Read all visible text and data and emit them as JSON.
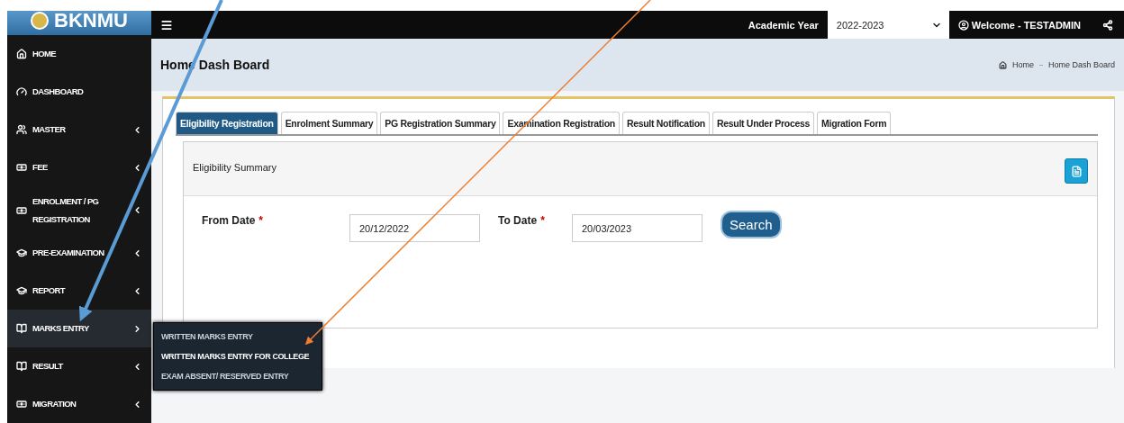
{
  "logo": {
    "text": "BKNMU"
  },
  "top_bar": {
    "academic_year_label": "Academic Year",
    "academic_year": "2022-2023",
    "welcome": "Welcome - TESTADMIN"
  },
  "sidebar": {
    "items": [
      {
        "label": "HOME",
        "has_submenu": false,
        "expanded": false
      },
      {
        "label": "DASHBOARD",
        "has_submenu": false,
        "expanded": false
      },
      {
        "label": "MASTER",
        "has_submenu": true,
        "expanded": false
      },
      {
        "label": "FEE",
        "has_submenu": true,
        "expanded": false
      },
      {
        "label": "ENROLMENT / PG REGISTRATION",
        "has_submenu": true,
        "expanded": false
      },
      {
        "label": "PRE-EXAMINATION",
        "has_submenu": true,
        "expanded": false
      },
      {
        "label": "REPORT",
        "has_submenu": true,
        "expanded": false
      },
      {
        "label": "MARKS ENTRY",
        "has_submenu": true,
        "expanded": true,
        "children": [
          {
            "label": "WRITTEN MARKS ENTRY",
            "selected": false
          },
          {
            "label": "WRITTEN MARKS ENTRY FOR COLLEGE",
            "selected": true
          },
          {
            "label": "EXAM ABSENT/ RESERVED ENTRY",
            "selected": false
          }
        ]
      },
      {
        "label": "RESULT",
        "has_submenu": true,
        "expanded": false
      },
      {
        "label": "MIGRATION",
        "has_submenu": true,
        "expanded": false
      }
    ]
  },
  "page_header": {
    "title": "Home Dash Board",
    "breadcrumbs": [
      "Home",
      "Home Dash Board"
    ]
  },
  "tabs": [
    {
      "label": "Eligibility Registration",
      "selected": true
    },
    {
      "label": "Enrolment Summary",
      "selected": false
    },
    {
      "label": "PG Registration Summary",
      "selected": false
    },
    {
      "label": "Examination Registration",
      "selected": false
    },
    {
      "label": "Result Notification",
      "selected": false
    },
    {
      "label": "Result Under Process",
      "selected": false
    },
    {
      "label": "Migration Form",
      "selected": false
    }
  ],
  "panel": {
    "title": "Eligibility Summary",
    "fields": [
      {
        "label": "From Date",
        "required_mark": "*",
        "value": "20/12/2022"
      },
      {
        "label": "To Date",
        "required_mark": "*",
        "value": "20/03/2023"
      }
    ],
    "search_button": "Search"
  }
}
